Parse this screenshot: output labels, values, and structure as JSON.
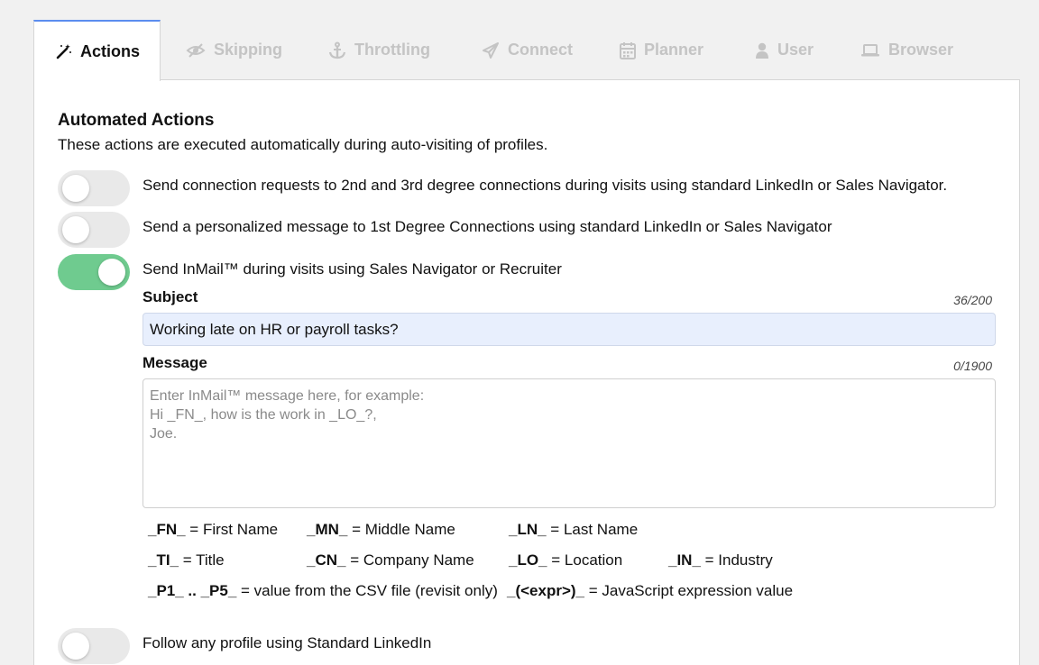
{
  "tabs": [
    {
      "label": "Actions",
      "icon": "magic-wand-icon",
      "active": true
    },
    {
      "label": "Skipping",
      "icon": "eye-slash-icon",
      "active": false
    },
    {
      "label": "Throttling",
      "icon": "anchor-icon",
      "active": false
    },
    {
      "label": "Connect",
      "icon": "paper-plane-icon",
      "active": false
    },
    {
      "label": "Planner",
      "icon": "calendar-icon",
      "active": false
    },
    {
      "label": "User",
      "icon": "user-icon",
      "active": false
    },
    {
      "label": "Browser",
      "icon": "laptop-icon",
      "active": false
    }
  ],
  "section": {
    "title": "Automated Actions",
    "description": "These actions are executed automatically during auto-visiting of profiles."
  },
  "toggles": [
    {
      "label": "Send connection requests to 2nd and 3rd degree connections during visits using standard LinkedIn or Sales Navigator.",
      "on": false
    },
    {
      "label": "Send a personalized message to 1st Degree Connections using standard LinkedIn or Sales Navigator",
      "on": false
    },
    {
      "label": "Send InMail™ during visits using Sales Navigator or Recruiter",
      "on": true
    },
    {
      "label": "Follow any profile using Standard LinkedIn",
      "on": false
    }
  ],
  "subject": {
    "label": "Subject",
    "counter": "36/200",
    "value": "Working late on HR or payroll tasks?"
  },
  "message": {
    "label": "Message",
    "counter": "0/1900",
    "value": "",
    "placeholder": "Enter InMail™ message here, for example:\nHi _FN_, how is the work in _LO_?,\nJoe."
  },
  "legend": [
    {
      "key": "_FN_",
      "desc": " = First Name"
    },
    {
      "key": "_MN_",
      "desc": " = Middle Name"
    },
    {
      "key": "_LN_",
      "desc": " = Last Name"
    },
    {
      "key": "_TI_",
      "desc": " = Title"
    },
    {
      "key": "_CN_",
      "desc": " = Company Name"
    },
    {
      "key": "_LO_",
      "desc": " = Location"
    },
    {
      "key": "_IN_",
      "desc": " = Industry"
    },
    {
      "key": "_P1_ .. _P5_",
      "desc": " = value from the CSV file (revisit only)"
    },
    {
      "key": "_(<expr>)_",
      "desc": " = JavaScript expression value"
    }
  ],
  "colors": {
    "toggle_on": "#6fcb8f",
    "toggle_off": "#e9e9e9",
    "active_tab_accent": "#5b8def",
    "subject_bg": "#e8effd"
  }
}
